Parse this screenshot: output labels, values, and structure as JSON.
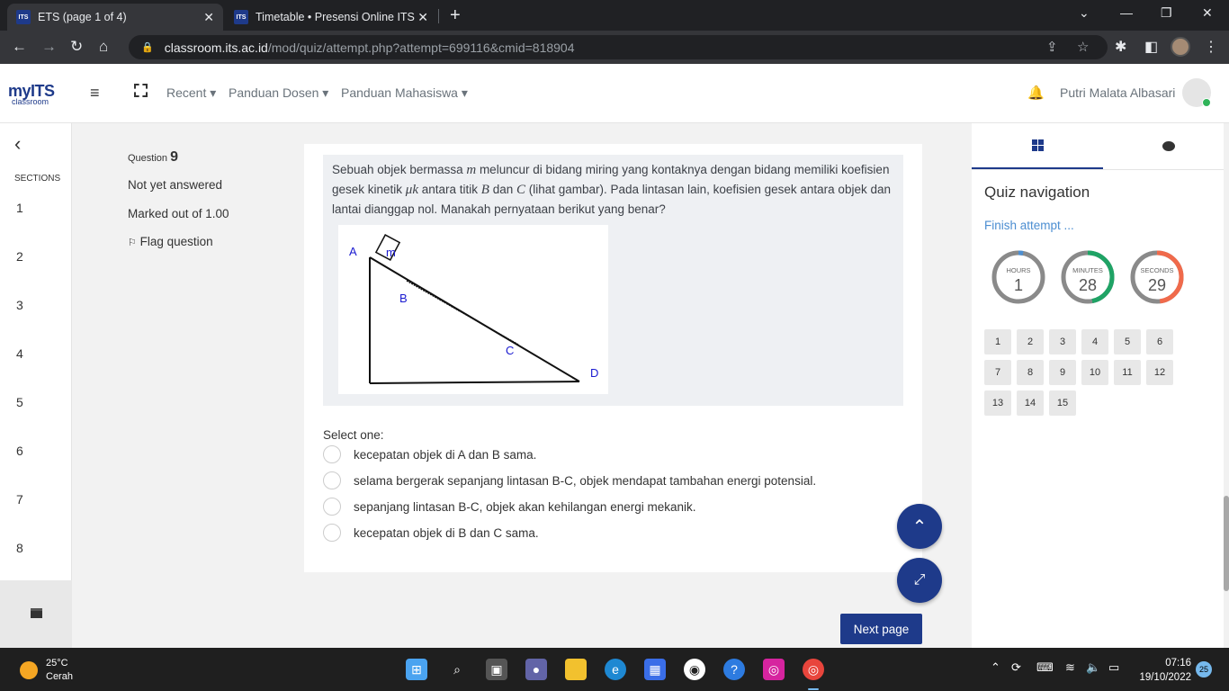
{
  "browser": {
    "tabs": [
      {
        "title": "ETS (page 1 of 4)",
        "favicon": "ITS"
      },
      {
        "title": "Timetable • Presensi Online ITS",
        "favicon": "ITS"
      }
    ],
    "url_host": "classroom.its.ac.id",
    "url_path": "/mod/quiz/attempt.php?attempt=699116&cmid=818904"
  },
  "navbar": {
    "logo_main": "myITS",
    "logo_sub": "classroom",
    "menu": [
      "Recent",
      "Panduan Dosen",
      "Panduan Mahasiswa"
    ],
    "user_name": "Putri Malata Albasari"
  },
  "left_drawer": {
    "sections_label": "SECTIONS",
    "sections": [
      "1",
      "2",
      "3",
      "4",
      "5",
      "6",
      "7",
      "8"
    ]
  },
  "question_info": {
    "label": "Question",
    "number": "9",
    "status": "Not yet answered",
    "marks": "Marked out of 1.00",
    "flag": "Flag question"
  },
  "question": {
    "text_1": "Sebuah objek bermassa ",
    "var_m": "m",
    "text_2": " meluncur di bidang miring yang kontaknya dengan bidang memiliki koefisien gesek kinetik ",
    "var_mu": "μk",
    "text_3": " antara titik ",
    "var_b": "B",
    "text_4": " dan ",
    "var_c": "C",
    "text_5": " (lihat gambar). Pada lintasan lain, koefisien gesek antara objek dan lantai dianggap nol. Manakah pernyataan berikut yang benar?",
    "figure_labels": {
      "a": "A",
      "m": "m",
      "b": "B",
      "c": "C",
      "d": "D"
    },
    "select_one": "Select one:",
    "options": [
      "kecepatan objek di A dan B sama.",
      "selama bergerak sepanjang lintasan B-C, objek mendapat tambahan energi potensial.",
      "sepanjang lintasan B-C, objek akan kehilangan energi mekanik.",
      "kecepatan objek di B dan C sama."
    ],
    "next_label": "Next page"
  },
  "quiz_nav": {
    "title": "Quiz navigation",
    "finish": "Finish attempt ...",
    "timers": [
      {
        "label": "HOURS",
        "value": "1",
        "fraction": 0.03,
        "color": "#4c8ed1"
      },
      {
        "label": "MINUTES",
        "value": "28",
        "fraction": 0.47,
        "color": "#1fa365"
      },
      {
        "label": "SECONDS",
        "value": "29",
        "fraction": 0.48,
        "color": "#f06a4b"
      }
    ],
    "questions": [
      "1",
      "2",
      "3",
      "4",
      "5",
      "6",
      "7",
      "8",
      "9",
      "10",
      "11",
      "12",
      "13",
      "14",
      "15"
    ]
  },
  "taskbar": {
    "temp": "25°C",
    "weather": "Cerah",
    "time": "07:16",
    "date": "19/10/2022",
    "notifications": "25"
  }
}
